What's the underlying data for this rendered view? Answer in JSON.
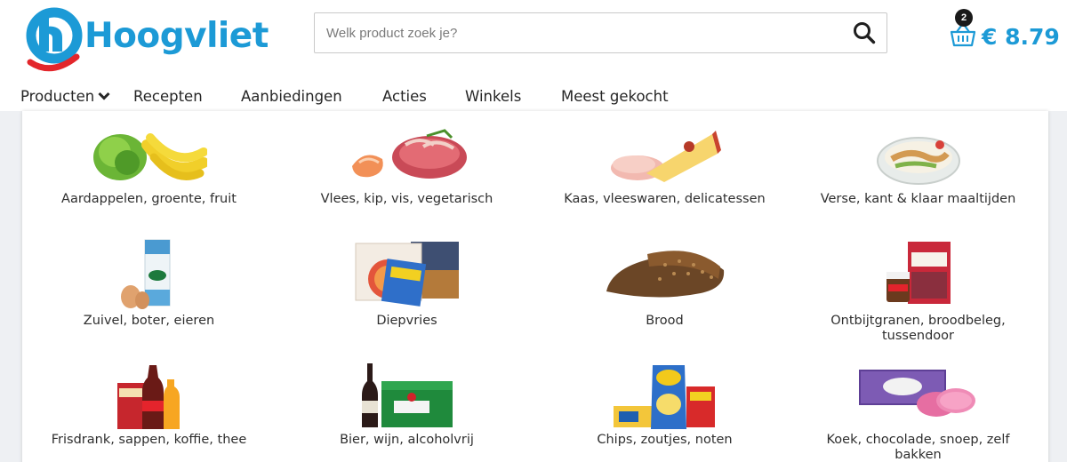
{
  "brand": {
    "name": "Hoogvliet",
    "primary_color": "#1c9ad6",
    "accent_color": "#e3262b"
  },
  "search": {
    "placeholder": "Welk product zoek je?",
    "value": "",
    "icon": "search-icon"
  },
  "cart": {
    "count": "2",
    "total": "€ 8.79",
    "icon": "basket-icon"
  },
  "nav": {
    "items": [
      {
        "label": "Producten",
        "has_dropdown": true,
        "active": true
      },
      {
        "label": "Recepten"
      },
      {
        "label": "Aanbiedingen"
      },
      {
        "label": "Acties"
      },
      {
        "label": "Winkels"
      },
      {
        "label": "Meest gekocht"
      }
    ]
  },
  "categories": [
    {
      "label": "Aardappelen, groente, fruit",
      "icon": "produce-image"
    },
    {
      "label": "Vlees, kip, vis, vegetarisch",
      "icon": "meat-image"
    },
    {
      "label": "Kaas, vleeswaren, delicatessen",
      "icon": "cheese-image"
    },
    {
      "label": "Verse, kant & klaar maaltijden",
      "icon": "ready-meal-image"
    },
    {
      "label": "Zuivel, boter, eieren",
      "icon": "dairy-image"
    },
    {
      "label": "Diepvries",
      "icon": "frozen-image"
    },
    {
      "label": "Brood",
      "icon": "bread-image"
    },
    {
      "label": "Ontbijtgranen, broodbeleg, tussendoor",
      "icon": "cereal-image"
    },
    {
      "label": "Frisdrank, sappen, koffie, thee",
      "icon": "drinks-image"
    },
    {
      "label": "Bier, wijn, alcoholvrij",
      "icon": "beer-image"
    },
    {
      "label": "Chips, zoutjes, noten",
      "icon": "chips-image"
    },
    {
      "label": "Koek, chocolade, snoep, zelf bakken",
      "icon": "cookies-image"
    }
  ]
}
